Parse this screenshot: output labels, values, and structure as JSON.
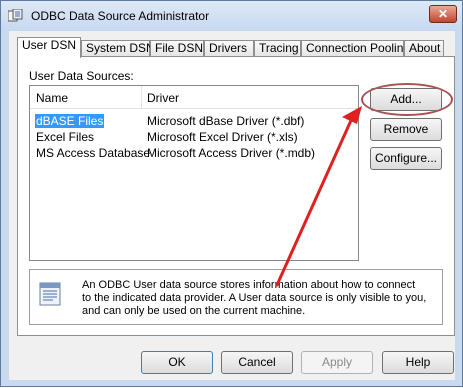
{
  "window": {
    "title": "ODBC Data Source Administrator"
  },
  "tabs": [
    {
      "label": "User DSN"
    },
    {
      "label": "System DSN"
    },
    {
      "label": "File DSN"
    },
    {
      "label": "Drivers"
    },
    {
      "label": "Tracing"
    },
    {
      "label": "Connection Pooling"
    },
    {
      "label": "About"
    }
  ],
  "user_dsn": {
    "section_label": "User Data Sources:",
    "columns": {
      "name": "Name",
      "driver": "Driver"
    },
    "rows": [
      {
        "name": "dBASE Files",
        "driver": "Microsoft dBase Driver (*.dbf)"
      },
      {
        "name": "Excel Files",
        "driver": "Microsoft Excel Driver (*.xls)"
      },
      {
        "name": "MS Access Database",
        "driver": "Microsoft Access Driver (*.mdb)"
      }
    ],
    "selected_row": "dBASE Files",
    "buttons": {
      "add": "Add...",
      "remove": "Remove",
      "configure": "Configure..."
    },
    "info": "An ODBC User data source stores information about how to connect to the indicated data provider.   A User data source is only visible to you, and can only be used on the current machine."
  },
  "dialog_buttons": {
    "ok": "OK",
    "cancel": "Cancel",
    "apply": "Apply",
    "help": "Help"
  },
  "colors": {
    "annotation": "#e02020",
    "highlight_ring": "#a85454",
    "selection": "#3399ff"
  }
}
